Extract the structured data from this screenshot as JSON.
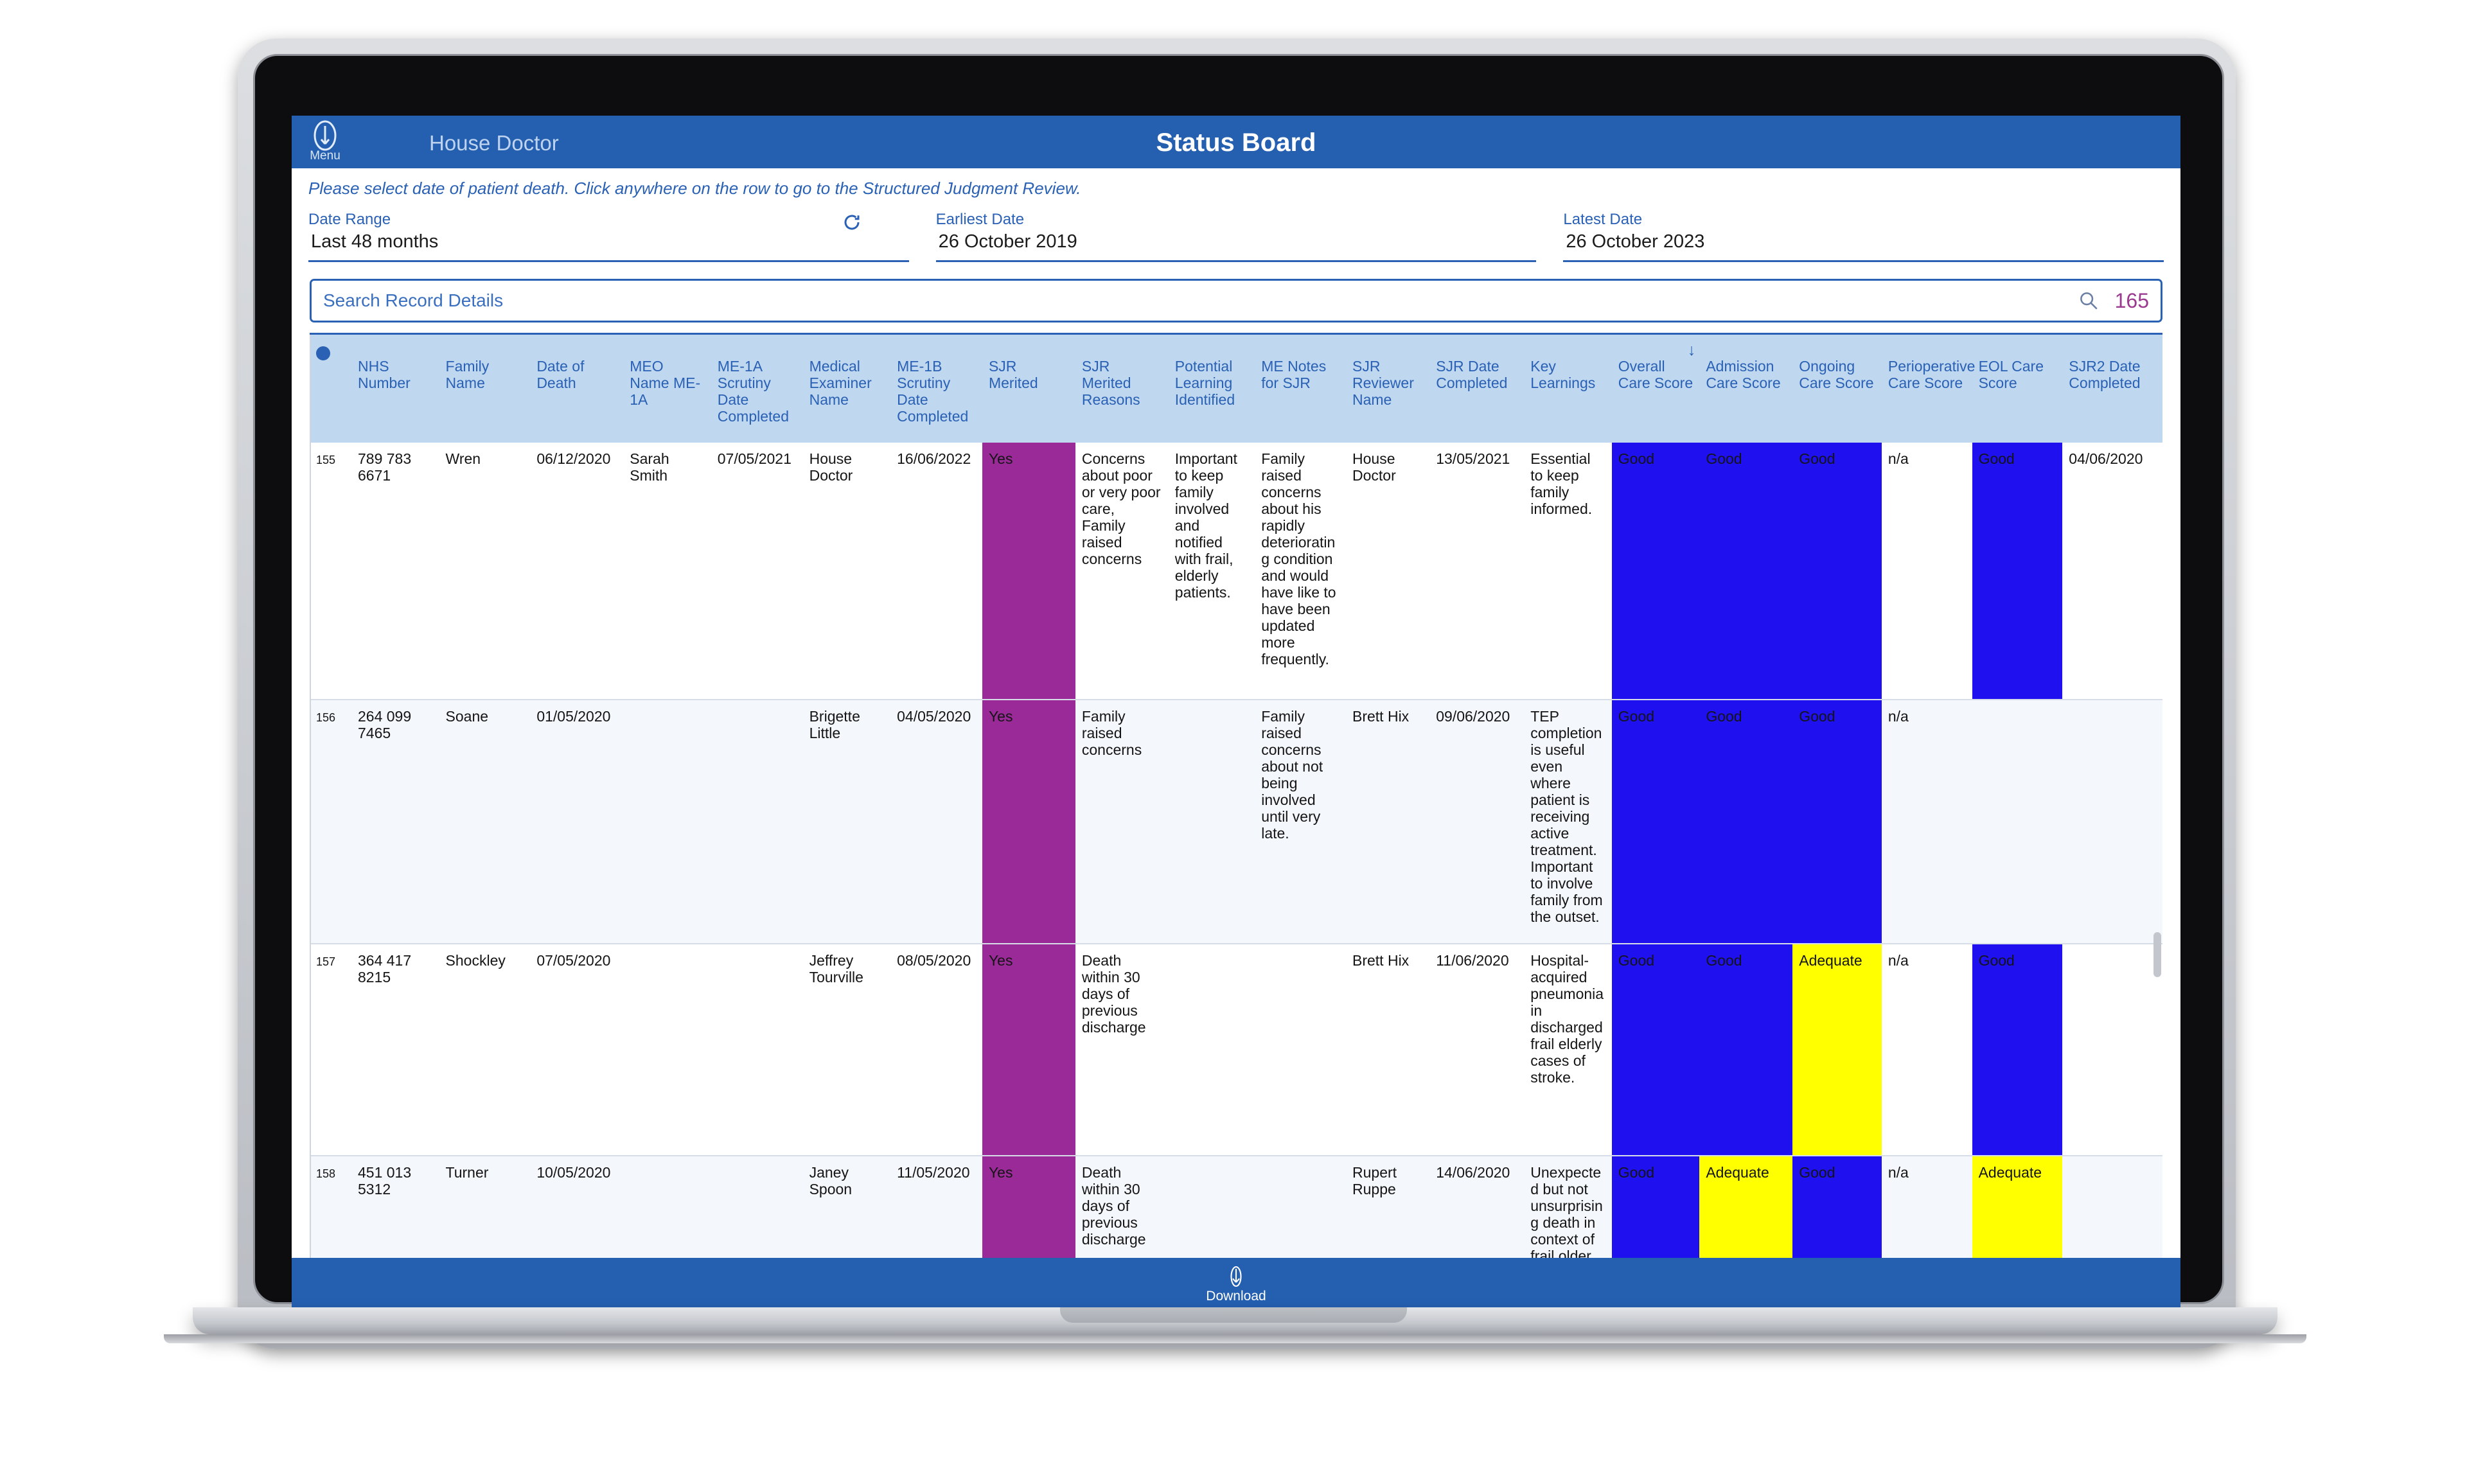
{
  "app": {
    "menu_label": "Menu",
    "menu_icon": "droplet-menu-icon",
    "user_name": "House Doctor",
    "title": "Status Board",
    "hint": "Please select date of patient death. Click anywhere on the row to go to the Structured Judgment Review."
  },
  "filters": {
    "date_range": {
      "label": "Date Range",
      "value": "Last 48 months"
    },
    "earliest_date": {
      "label": "Earliest Date",
      "value": "26 October 2019"
    },
    "latest_date": {
      "label": "Latest Date",
      "value": "26 October 2023"
    },
    "refresh_icon": "refresh-icon"
  },
  "search": {
    "placeholder": "Search Record Details",
    "value": "",
    "icon": "search-icon",
    "record_count": "165"
  },
  "table": {
    "sort_indicator": "↓",
    "sorted_column": "Overall Care Score",
    "columns": [
      "NHS Number",
      "Family Name",
      "Date of Death",
      "MEO Name ME-1A",
      "ME-1A Scrutiny Date Completed",
      "Medical Examiner Name",
      "ME-1B Scrutiny Date Completed",
      "SJR Merited",
      "SJR Merited Reasons",
      "Potential Learning Identified",
      "ME Notes for SJR",
      "SJR Reviewer Name",
      "SJR Date Completed",
      "Key Learnings",
      "Overall Care Score",
      "Admission Care Score",
      "Ongoing Care Score",
      "Perioperative Care Score",
      "EOL Care Score",
      "SJR2 Date Completed"
    ],
    "rows": [
      {
        "index": "155",
        "nhs_number": "789 783 6671",
        "family_name": "Wren",
        "date_of_death": "06/12/2020",
        "meo_name_me1a": "Sarah Smith",
        "me1a_scrutiny_date": "07/05/2021",
        "medical_examiner_name": "House Doctor",
        "me1b_scrutiny_date": "16/06/2022",
        "sjr_merited": "Yes",
        "sjr_merited_reasons": "Concerns about poor or very poor care, Family raised concerns",
        "potential_learning": "Important to keep family involved and notified with frail, elderly patients.",
        "me_notes_for_sjr": "Family raised concerns about his rapidly deteriorating condition and would have like to have been updated more frequently.",
        "sjr_reviewer_name": "House Doctor",
        "sjr_date_completed": "13/05/2021",
        "key_learnings": "Essential to keep family informed.",
        "overall_care_score": "Good",
        "admission_care_score": "Good",
        "ongoing_care_score": "Good",
        "perioperative_care_score": "n/a",
        "eol_care_score": "Good",
        "sjr2_date_completed": "04/06/2020"
      },
      {
        "index": "156",
        "nhs_number": "264 099 7465",
        "family_name": "Soane",
        "date_of_death": "01/05/2020",
        "meo_name_me1a": "",
        "me1a_scrutiny_date": "",
        "medical_examiner_name": "Brigette Little",
        "me1b_scrutiny_date": "04/05/2020",
        "sjr_merited": "Yes",
        "sjr_merited_reasons": "Family raised concerns",
        "potential_learning": "",
        "me_notes_for_sjr": "Family raised concerns about not being involved until very late.",
        "sjr_reviewer_name": "Brett Hix",
        "sjr_date_completed": "09/06/2020",
        "key_learnings": "TEP completion is useful even where patient is receiving active treatment. Important to involve family from the outset.",
        "overall_care_score": "Good",
        "admission_care_score": "Good",
        "ongoing_care_score": "Good",
        "perioperative_care_score": "n/a",
        "eol_care_score": "",
        "sjr2_date_completed": ""
      },
      {
        "index": "157",
        "nhs_number": "364 417 8215",
        "family_name": "Shockley",
        "date_of_death": "07/05/2020",
        "meo_name_me1a": "",
        "me1a_scrutiny_date": "",
        "medical_examiner_name": "Jeffrey Tourville",
        "me1b_scrutiny_date": "08/05/2020",
        "sjr_merited": "Yes",
        "sjr_merited_reasons": "Death within 30 days of previous discharge",
        "potential_learning": "",
        "me_notes_for_sjr": "",
        "sjr_reviewer_name": "Brett Hix",
        "sjr_date_completed": "11/06/2020",
        "key_learnings": "Hospital-acquired pneumonia in discharged frail elderly cases of stroke.",
        "overall_care_score": "Good",
        "admission_care_score": "Good",
        "ongoing_care_score": "Adequate",
        "perioperative_care_score": "n/a",
        "eol_care_score": "Good",
        "sjr2_date_completed": ""
      },
      {
        "index": "158",
        "nhs_number": "451 013 5312",
        "family_name": "Turner",
        "date_of_death": "10/05/2020",
        "meo_name_me1a": "",
        "me1a_scrutiny_date": "",
        "medical_examiner_name": "Janey Spoon",
        "me1b_scrutiny_date": "11/05/2020",
        "sjr_merited": "Yes",
        "sjr_merited_reasons": "Death within 30 days of previous discharge",
        "potential_learning": "",
        "me_notes_for_sjr": "",
        "sjr_reviewer_name": "Rupert Ruppe",
        "sjr_date_completed": "14/06/2020",
        "key_learnings": "Unexpected but not unsurprising death in context of frail older person with multiple co-",
        "overall_care_score": "Good",
        "admission_care_score": "Adequate",
        "ongoing_care_score": "Good",
        "perioperative_care_score": "n/a",
        "eol_care_score": "Adequate",
        "sjr2_date_completed": ""
      }
    ]
  },
  "footer": {
    "download_label": "Download",
    "download_icon": "download-icon"
  },
  "colors": {
    "brand_blue": "#255fb0",
    "header_blue": "#bfd7ef",
    "score_good": "#1f10f0",
    "score_adequate": "#ffff00",
    "sjr_merited": "#9b2a99",
    "count_purple": "#9b3b8f"
  }
}
